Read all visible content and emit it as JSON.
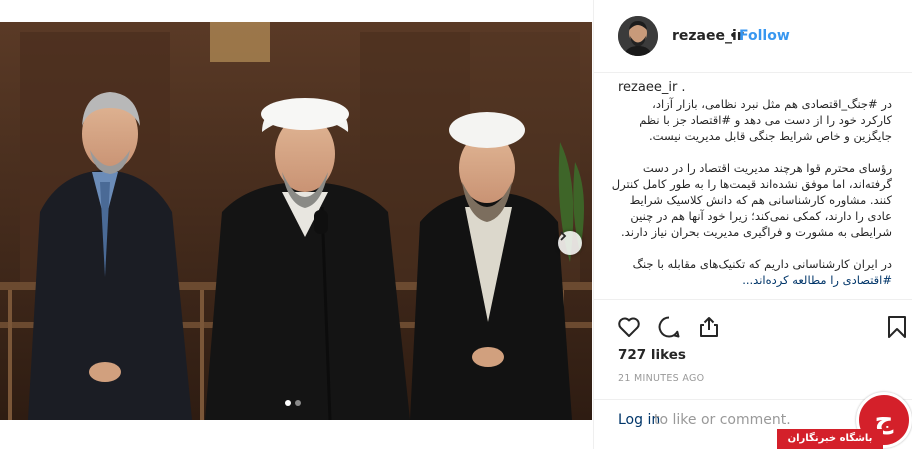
{
  "post": {
    "username": "rezaee_ir",
    "separator": "•",
    "follow_label": "Follow",
    "caption_username": "rezaee_ir .",
    "caption_lines": [
      "در #جنگ_اقتصادی هم مثل نبرد نظامی، بازار آزاد،",
      "کارکرد خود را از دست می دهد و #اقتصاد جز با نظم",
      "جایگزین و خاص شرایط جنگی قابل مدیریت نیست."
    ],
    "caption_para2": [
      "رؤسای محترم قوا هرچند مدیریت اقتصاد را در دست",
      "گرفته‌اند، اما موفق نشده‌اند قیمت‌ها را به طور کامل کنترل",
      "کنند. مشاوره کارشناسانی هم که دانش کلاسیک شرایط",
      "عادی را دارند، کمکی نمی‌کند؛ زیرا خود آنها هم در چنین",
      "شرایطی به مشورت و فراگیری مدیریت بحران نیاز دارند."
    ],
    "caption_para3": [
      "در ایران کارشناسانی داریم که تکنیک‌های مقابله با جنگ",
      "#اقتصادی را مطالعه کرده‌اند..."
    ],
    "likes": "727 likes",
    "timestamp": "21 MINUTES AGO",
    "login_link": "Log in",
    "login_rest": "to like or comment.",
    "icons": {
      "like": "heart-icon",
      "comment": "comment-icon",
      "share": "share-icon",
      "save": "bookmark-icon",
      "next": "chevron-right-icon"
    }
  },
  "carousel": {
    "current": 1,
    "total": 2
  },
  "watermark": {
    "text": "باشگاه خبرنگاران",
    "glyph": "ج"
  },
  "colors": {
    "link": "#003569",
    "follow": "#3897f0",
    "muted": "#999999",
    "border": "#efefef",
    "watermark": "#d4202a"
  }
}
